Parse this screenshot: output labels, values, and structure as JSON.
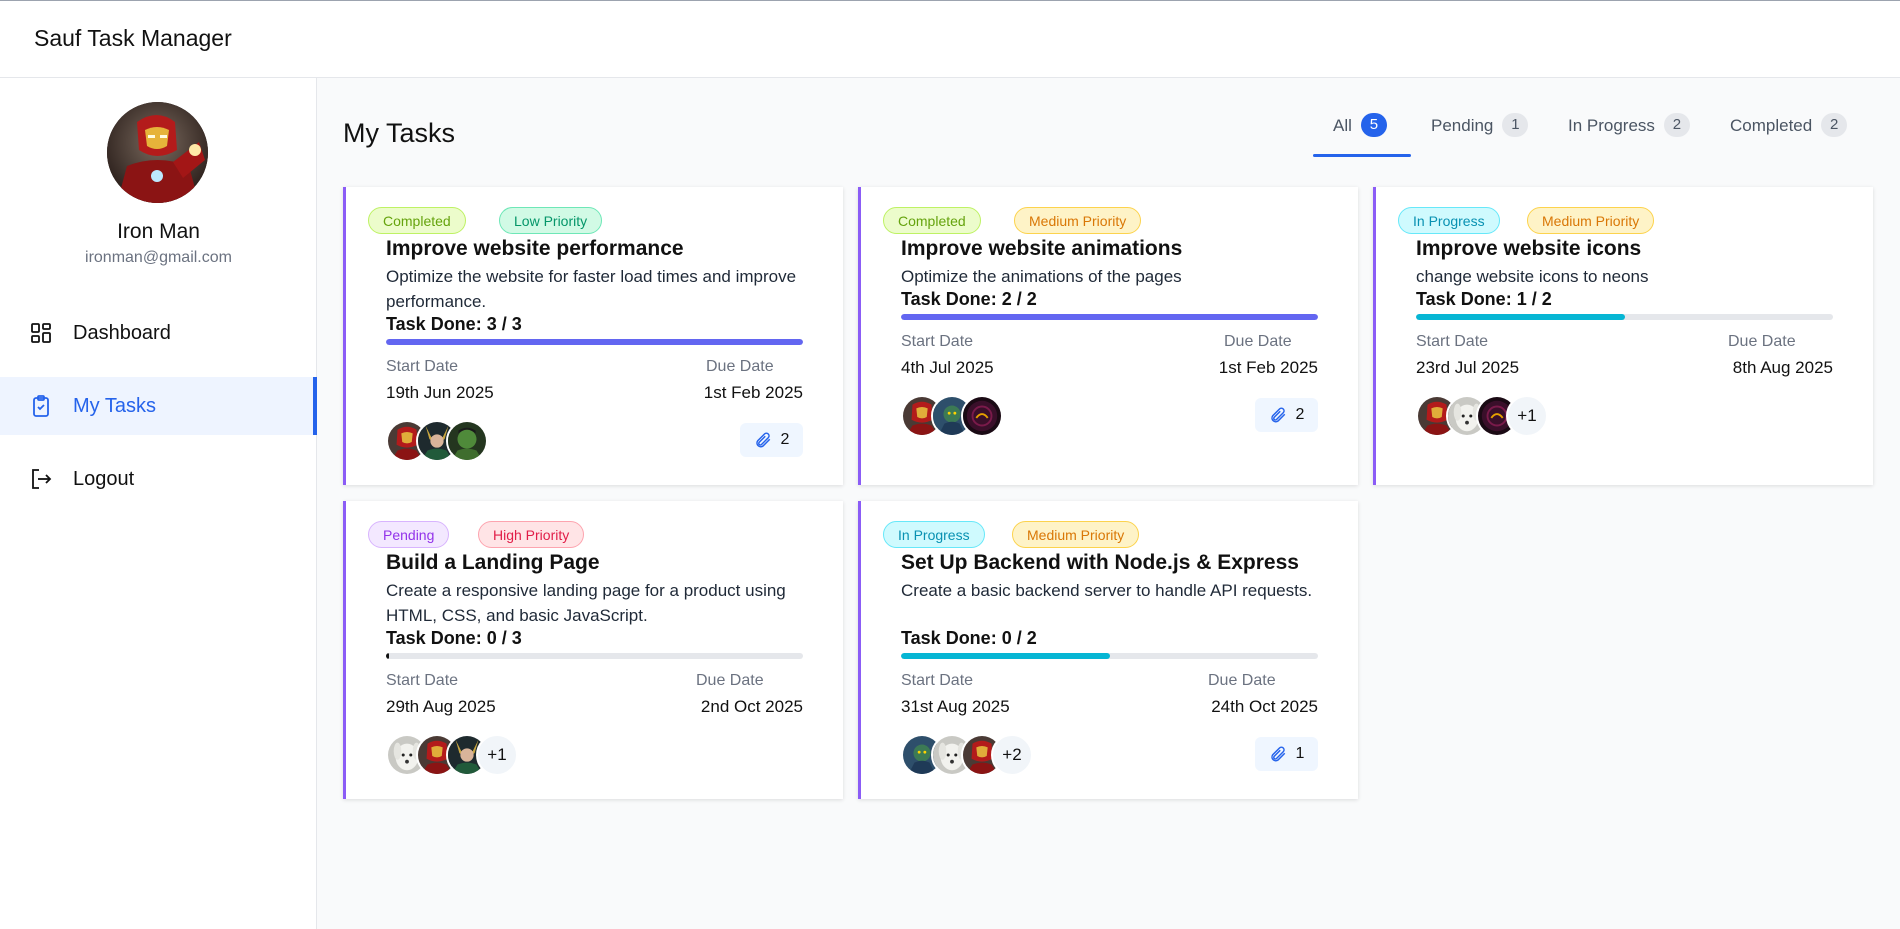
{
  "app": {
    "title": "Sauf Task Manager"
  },
  "user": {
    "name": "Iron Man",
    "email": "ironman@gmail.com"
  },
  "sidebar": {
    "items": [
      {
        "label": "Dashboard",
        "icon": "dashboard-icon"
      },
      {
        "label": "My Tasks",
        "icon": "clipboard-check-icon",
        "active": true
      },
      {
        "label": "Logout",
        "icon": "logout-icon"
      }
    ]
  },
  "page": {
    "title": "My Tasks"
  },
  "tabs": [
    {
      "label": "All",
      "count": "5",
      "active": true
    },
    {
      "label": "Pending",
      "count": "1"
    },
    {
      "label": "In Progress",
      "count": "2"
    },
    {
      "label": "Completed",
      "count": "2"
    }
  ],
  "colors": {
    "accent": "#2563eb",
    "card_border": "#8b5cf6",
    "progress_complete": "#6366f1",
    "progress_partial": "#06b6d4"
  },
  "labels": {
    "start_date": "Start Date",
    "due_date": "Due Date"
  },
  "tasks": [
    {
      "status": "Completed",
      "priority": "Low Priority",
      "title": "Improve website performance",
      "description": "Optimize the website for faster load times and improve performance.",
      "done_text": "Task Done: 3 / 3",
      "progress": 1.0,
      "start": "19th Jun 2025",
      "due": "1st Feb 2025",
      "avatars": [
        "ironman",
        "loki",
        "hulk"
      ],
      "more": "",
      "attachments": "2"
    },
    {
      "status": "Completed",
      "priority": "Medium Priority",
      "title": "Improve website animations",
      "description": "Optimize the animations of the pages",
      "done_text": "Task Done: 2 / 2",
      "progress": 1.0,
      "start": "4th Jul 2025",
      "due": "1st Feb 2025",
      "avatars": [
        "ironman",
        "warrior",
        "dark"
      ],
      "more": "",
      "attachments": "2"
    },
    {
      "status": "In Progress",
      "priority": "Medium Priority",
      "title": "Improve website icons",
      "description": "change website icons to neons",
      "done_text": "Task Done: 1 / 2",
      "progress": 0.5,
      "start": "23rd Jul 2025",
      "due": "8th Aug 2025",
      "avatars": [
        "ironman",
        "dog",
        "dark"
      ],
      "more": "+1",
      "attachments": ""
    },
    {
      "status": "Pending",
      "priority": "High Priority",
      "title": "Build a Landing Page",
      "description": "Create a responsive landing page for a product using HTML, CSS, and basic JavaScript.",
      "done_text": "Task Done: 0 / 3",
      "progress": 0.0,
      "start": "29th Aug 2025",
      "due": "2nd Oct 2025",
      "avatars": [
        "dog",
        "ironman",
        "loki"
      ],
      "more": "+1",
      "attachments": ""
    },
    {
      "status": "In Progress",
      "priority": "Medium Priority",
      "title": "Set Up Backend with Node.js & Express",
      "description": "Create a basic backend server to handle API requests.",
      "done_text": "Task Done: 0 / 2",
      "progress": 0.5,
      "start": "31st Aug 2025",
      "due": "24th Oct 2025",
      "avatars": [
        "warrior",
        "dog",
        "ironman"
      ],
      "more": "+2",
      "attachments": "1"
    }
  ]
}
